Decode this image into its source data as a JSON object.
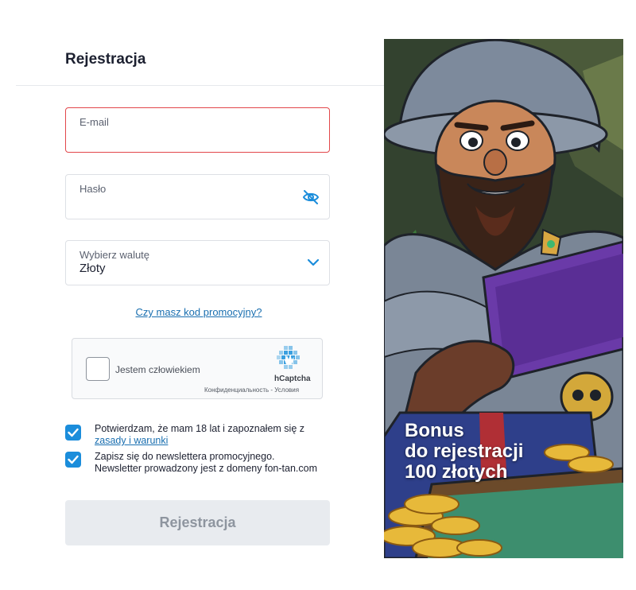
{
  "form": {
    "title": "Rejestracja",
    "email": {
      "label": "E-mail",
      "value": ""
    },
    "password": {
      "label": "Hasło",
      "value": "",
      "toggle_icon": "eye-off-icon"
    },
    "currency": {
      "label": "Wybierz walutę",
      "value": "Złoty",
      "icon": "chevron-down-icon"
    },
    "promo_link": "Czy masz kod promocyjny?",
    "captcha": {
      "checkbox_label": "Jestem człowiekiem",
      "brand": "hCaptcha",
      "footer": "Конфиденциальность - Условия"
    },
    "terms": {
      "text": "Potwierdzam, że mam 18 lat i zapoznałem się z",
      "link": "zasady i warunki",
      "checked": true
    },
    "newsletter": {
      "line1": "Zapisz się do newslettera promocyjnego.",
      "line2": "Newsletter prowadzony jest z domeny fon-tan.com",
      "checked": true
    },
    "submit_label": "Rejestracja"
  },
  "banner": {
    "line1": "Bonus",
    "line2": "do rejestracji",
    "line3": "100 złotych"
  },
  "colors": {
    "accent": "#1b8ddb",
    "link": "#1a6fb0",
    "error_border": "#e2474a",
    "disabled_button": "#e8ebef"
  }
}
